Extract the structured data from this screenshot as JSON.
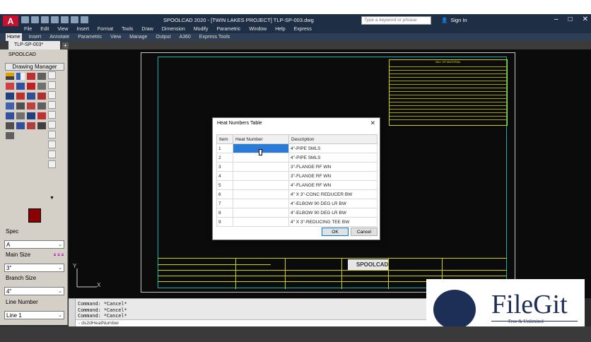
{
  "window": {
    "title": "SPOOLCAD 2020 - [TWIN LAKES PROJECT]   TLP-SP-003.dwg",
    "search_placeholder": "Type a keyword or phrase",
    "sign_in": "Sign In"
  },
  "menu": [
    "File",
    "Edit",
    "View",
    "Insert",
    "Format",
    "Tools",
    "Draw",
    "Dimension",
    "Modify",
    "Parametric",
    "Window",
    "Help",
    "Express"
  ],
  "ribbon_tabs": [
    "Home",
    "Insert",
    "Annotate",
    "Parametric",
    "View",
    "Manage",
    "Output",
    "A360",
    "Express Tools"
  ],
  "doc_tab": "TLP-SP-003*",
  "left_panel": {
    "title": "SPOOLCAD",
    "drawing_manager": "Drawing Manager",
    "spec_label": "Spec",
    "spec_value": "A",
    "main_size_label": "Main Size",
    "main_size_value": "3\"",
    "branch_size_label": "Branch Size",
    "branch_size_value": "4\"",
    "line_number_label": "Line Number",
    "line_value": "Line 1"
  },
  "dialog": {
    "title": "Heat Numbers Table",
    "columns": [
      "Item",
      "Heat Number",
      "Description"
    ],
    "rows": [
      {
        "item": "1",
        "heat": "",
        "desc": "4\"-PIPE SMLS"
      },
      {
        "item": "2",
        "heat": "",
        "desc": "4\"-PIPE SMLS"
      },
      {
        "item": "3",
        "heat": "",
        "desc": "3\"-FLANGE RF WN"
      },
      {
        "item": "4",
        "heat": "",
        "desc": "3\"-FLANGE RF WN"
      },
      {
        "item": "5",
        "heat": "",
        "desc": "4\"-FLANGE RF WN"
      },
      {
        "item": "6",
        "heat": "",
        "desc": "4\" X 3\"-CONC REDUCER BW"
      },
      {
        "item": "7",
        "heat": "",
        "desc": "4\"-ELBOW 90 DEG LR BW"
      },
      {
        "item": "8",
        "heat": "",
        "desc": "4\"-ELBOW 90 DEG LR BW"
      },
      {
        "item": "9",
        "heat": "",
        "desc": "4\" X 3\"-REDUCING TEE BW"
      }
    ],
    "ok": "OK",
    "cancel": "Cancel"
  },
  "drawing": {
    "bom_title": "BILL OF MATERIAL",
    "logo_text": "SPOOLCAD",
    "axis_x": "X",
    "axis_y": "Y"
  },
  "command": {
    "history": [
      "Command: *Cancel*",
      "Command: *Cancel*",
      "Command: *Cancel*"
    ],
    "input": "- ds2dHeatNumber"
  },
  "watermark": {
    "name": "FileGit",
    "tagline": "Free & Unlimited"
  }
}
